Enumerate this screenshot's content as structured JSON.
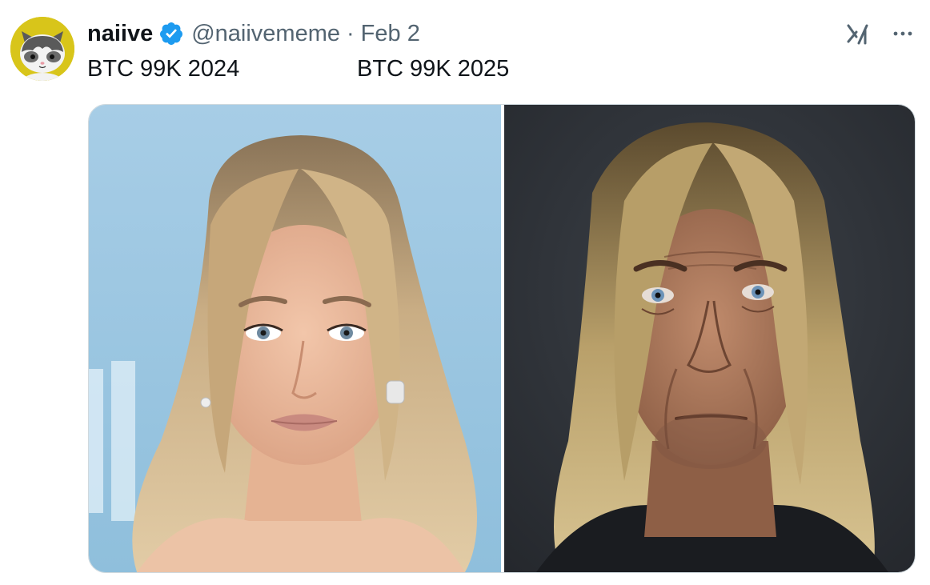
{
  "author": {
    "display_name": "naiive",
    "handle": "@naiivememe",
    "separator": "·",
    "date": "Feb 2",
    "avatar_icon": "cat-avatar-icon",
    "verified_icon": "verified-badge-icon"
  },
  "tweet": {
    "text_line_1": "BTC 99K 2024",
    "text_line_2": "BTC 99K 2025"
  },
  "actions": {
    "grok_icon": "grok-icon",
    "more_icon": "more-dots-icon"
  },
  "media": {
    "images": [
      {
        "name": "photo-woman-blonde",
        "background": "#a9cfe8"
      },
      {
        "name": "photo-man-long-hair",
        "background": "#2e3238"
      }
    ]
  },
  "colors": {
    "accent": "#1d9bf0",
    "secondary_text": "#536471",
    "primary_text": "#0f1419",
    "avatar_bg": "#d8c51a",
    "border": "#cfd9de"
  }
}
